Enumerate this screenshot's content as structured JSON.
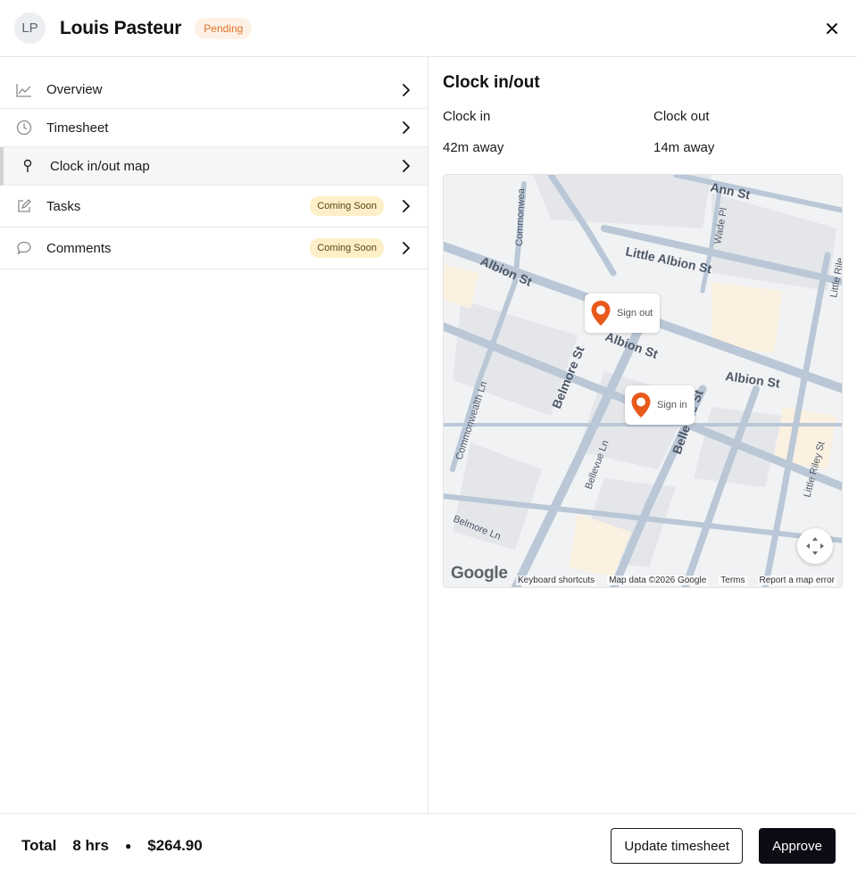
{
  "header": {
    "initials": "LP",
    "name": "Louis Pasteur",
    "status": "Pending"
  },
  "sidebar": {
    "items": [
      {
        "label": "Overview",
        "icon": "line-chart-icon"
      },
      {
        "label": "Timesheet",
        "icon": "clock-icon"
      },
      {
        "label": "Clock in/out map",
        "icon": "pin-icon",
        "active": true
      },
      {
        "label": "Tasks",
        "icon": "edit-icon",
        "badge": "Coming Soon"
      },
      {
        "label": "Comments",
        "icon": "comment-icon",
        "badge": "Coming Soon"
      }
    ]
  },
  "main": {
    "title": "Clock in/out",
    "clock_in": {
      "label": "Clock in",
      "value": "42m away"
    },
    "clock_out": {
      "label": "Clock out",
      "value": "14m away"
    },
    "map": {
      "markers": {
        "sign_out": "Sign out",
        "sign_in": "Sign in"
      },
      "streets": {
        "ann_st": "Ann St",
        "commonwealth": "Commonwea",
        "wade_pl": "Wade Pl",
        "little_riley_top": "Little Rile",
        "little_albion": "Little Albion St",
        "albion_left": "Albion St",
        "albion_mid": "Albion St",
        "albion_right": "Albion St",
        "commonwealth_ln": "Commonwealth Ln",
        "belmore_st": "Belmore St",
        "bellevue_st": "Bellevue St",
        "bellevue_ln": "Bellevue Ln",
        "little_riley": "Little Riley St",
        "belmore_ln": "Belmore Ln"
      },
      "logo": "Google",
      "footer": {
        "shortcuts": "Keyboard shortcuts",
        "data": "Map data ©2026 Google",
        "terms": "Terms",
        "report": "Report a map error"
      }
    }
  },
  "footer": {
    "total_label": "Total",
    "hours": "8 hrs",
    "amount": "$264.90",
    "update_label": "Update timesheet",
    "approve_label": "Approve"
  },
  "colors": {
    "accent_orange": "#e8591c",
    "pending_text": "#e0702a",
    "coming_soon_bg": "#fdf0c8",
    "approve_bg": "#0c0c14"
  }
}
